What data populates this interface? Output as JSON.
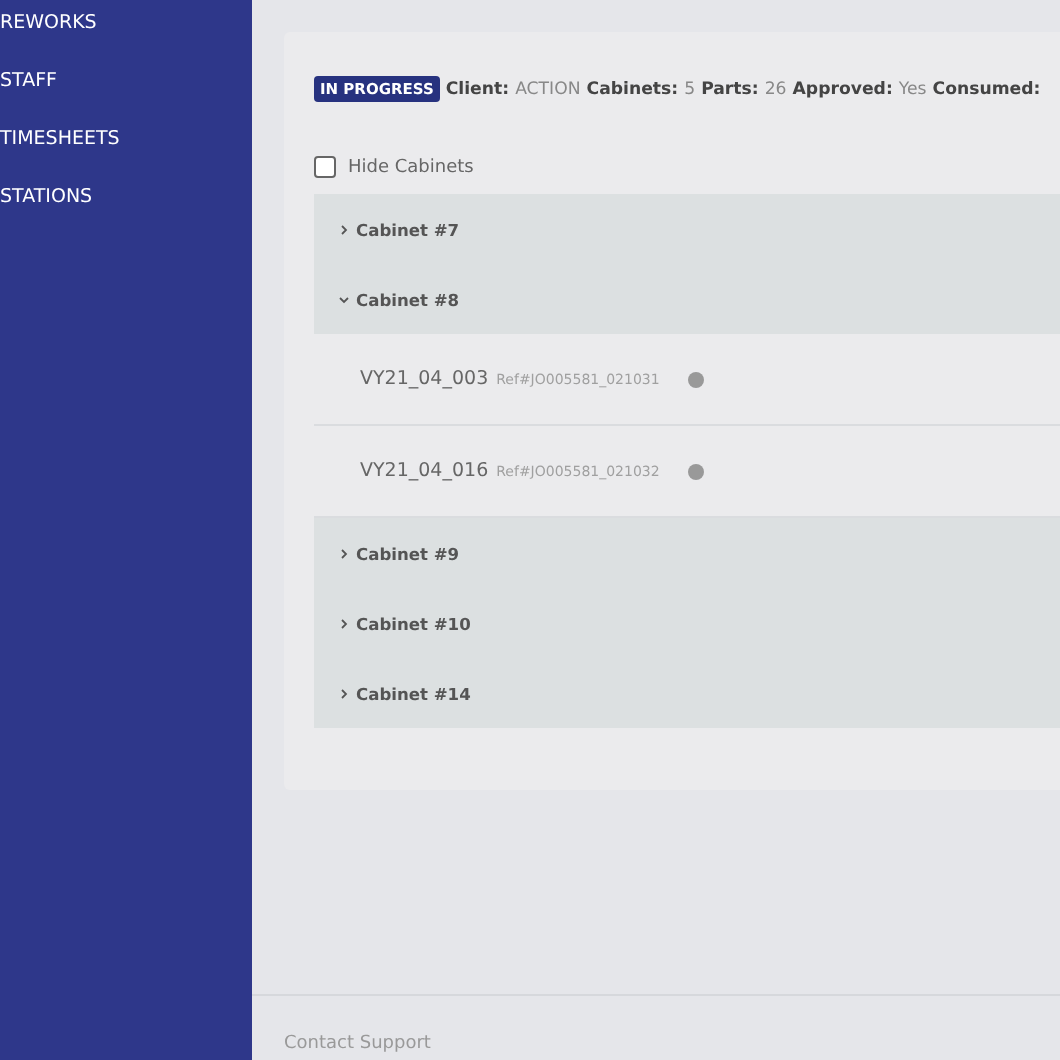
{
  "sidebar": {
    "items": [
      {
        "label": "REWORKS"
      },
      {
        "label": "STAFF"
      },
      {
        "label": "TIMESHEETS"
      },
      {
        "label": "STATIONS"
      }
    ]
  },
  "summary": {
    "status": "IN PROGRESS",
    "fields": [
      {
        "label": "Client:",
        "value": "ACTION"
      },
      {
        "label": "Cabinets:",
        "value": "5"
      },
      {
        "label": "Parts:",
        "value": "26"
      },
      {
        "label": "Approved:",
        "value": "Yes"
      },
      {
        "label": "Consumed:"
      }
    ]
  },
  "hide_cabinets": {
    "label": "Hide Cabinets",
    "checked": false
  },
  "cabinets": [
    {
      "name": "Cabinet #7",
      "expanded": false
    },
    {
      "name": "Cabinet #8",
      "expanded": true,
      "parts": [
        {
          "code": "VY21_04_003",
          "ref": "Ref#JO005581_021031"
        },
        {
          "code": "VY21_04_016",
          "ref": "Ref#JO005581_021032"
        }
      ]
    },
    {
      "name": "Cabinet #9",
      "expanded": false
    },
    {
      "name": "Cabinet #10",
      "expanded": false
    },
    {
      "name": "Cabinet #14",
      "expanded": false
    }
  ],
  "footer": {
    "link": "Contact Support"
  }
}
